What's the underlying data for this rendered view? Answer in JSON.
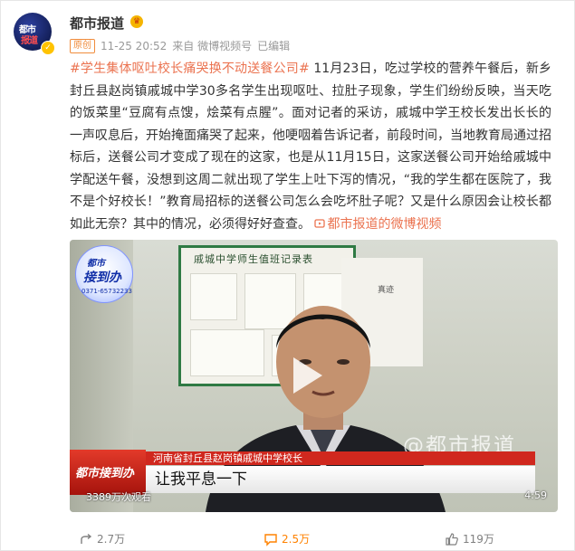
{
  "post": {
    "author": {
      "name": "都市报道",
      "avatar_text_1": "都市",
      "avatar_text_2": "报道"
    },
    "meta": {
      "tag": "原创",
      "timestamp": "11-25 20:52",
      "source": "来自 微博视频号",
      "edited": "已编辑"
    },
    "text": {
      "topic": "#学生集体呕吐校长痛哭换不动送餐公司#",
      "content": "11月23日，吃过学校的营养午餐后，新乡封丘县赵岗镇戚城中学30多名学生出现呕吐、拉肚子现象，学生们纷纷反映，当天吃的饭菜里“豆腐有点馊，烩菜有点腥”。面对记者的采访，戚城中学王校长发出长长的一声叹息后，开始掩面痛哭了起来，他哽咽着告诉记者，前段时间，当地教育局通过招标后，送餐公司才变成了现在的这家，也是从11月15日，这家送餐公司开始给戚城中学配送午餐，没想到这周二就出现了学生上吐下泻的情况，“我的学生都在医院了，我不是个好校长！”教育局招标的送餐公司怎么会吃坏肚子呢？又是什么原因会让校长都如此无奈？其中的情况，必须得好好查查。",
      "video_link": "都市报道的微博视频"
    },
    "video": {
      "logo_line1": "都市",
      "logo_line2": "接到办",
      "logo_phone": "0371-65732233",
      "board_title": "戚城中学师生值班记录表",
      "board_small": "真迹",
      "watermark": "@都市报道",
      "caption_logo": "都市接到办",
      "caption_name": "河南省封丘县赵岗镇戚城中学校长",
      "caption_subtitle": "让我平息一下",
      "views": "3389万次观看",
      "duration": "4:59"
    },
    "actions": {
      "share_count": "2.7万",
      "comment_count": "2.5万",
      "like_count": "119万"
    }
  },
  "colors": {
    "link": "#eb7350",
    "muted": "#999999",
    "caption_red": "#d0281e"
  }
}
